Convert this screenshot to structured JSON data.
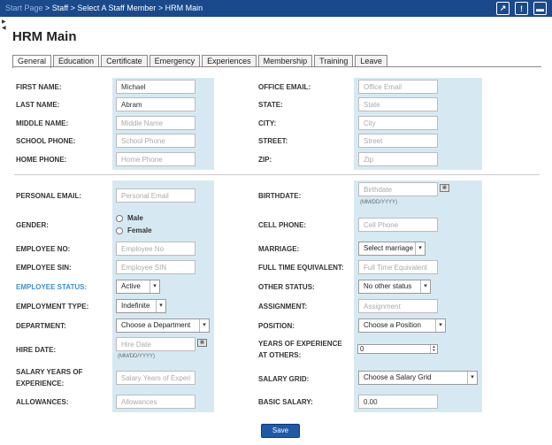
{
  "breadcrumb": {
    "start": "Start Page",
    "separator": " > ",
    "staff": "Staff",
    "select": "Select A Staff Member",
    "current": "HRM Main"
  },
  "top_icons": [
    "external-link-icon",
    "alert-icon",
    "print-icon"
  ],
  "page_title": "HRM Main",
  "tabs": [
    "General",
    "Education",
    "Certificate",
    "Emergency",
    "Experiences",
    "Membership",
    "Training",
    "Leave"
  ],
  "colors": {
    "header": "#1a4a8c",
    "panel": "#d6e9f3",
    "accent": "#3c8fd1",
    "button": "#1e5aa8"
  },
  "form": {
    "first_name": {
      "label": "FIRST NAME:",
      "value": "Michael"
    },
    "last_name": {
      "label": "LAST NAME:",
      "value": "Abram"
    },
    "middle_name": {
      "label": "MIDDLE NAME:",
      "placeholder": "Middle Name"
    },
    "school_phone": {
      "label": "SCHOOL PHONE:",
      "placeholder": "School Phone"
    },
    "home_phone": {
      "label": "HOME PHONE:",
      "placeholder": "Home Phone"
    },
    "office_email": {
      "label": "OFFICE EMAIL:",
      "placeholder": "Office Email"
    },
    "state": {
      "label": "STATE:",
      "placeholder": "State"
    },
    "city": {
      "label": "CITY:",
      "placeholder": "City"
    },
    "street": {
      "label": "STREET:",
      "placeholder": "Street"
    },
    "zip": {
      "label": "ZIP:",
      "placeholder": "Zip"
    },
    "personal_email": {
      "label": "PERSONAL EMAIL:",
      "placeholder": "Personal Email"
    },
    "gender": {
      "label": "GENDER:",
      "male": "Male",
      "female": "Female"
    },
    "employee_no": {
      "label": "EMPLOYEE NO:",
      "placeholder": "Employee No"
    },
    "employee_sin": {
      "label": "EMPLOYEE SIN:",
      "placeholder": "Employee SIN"
    },
    "employee_status": {
      "label": "EMPLOYEE STATUS:",
      "value": "Active"
    },
    "employment_type": {
      "label": "EMPLOYMENT TYPE:",
      "value": "Indefinite"
    },
    "department": {
      "label": "DEPARTMENT:",
      "value": "Choose a Department"
    },
    "hire_date": {
      "label": "HIRE DATE:",
      "placeholder": "Hire Date",
      "hint": "(MM/DD/YYYY)"
    },
    "salary_years": {
      "label": "SALARY YEARS OF EXPERIENCE:",
      "placeholder": "Salary Years of Experien"
    },
    "allowances": {
      "label": "ALLOWANCES:",
      "placeholder": "Allowances"
    },
    "birthdate": {
      "label": "BIRTHDATE:",
      "placeholder": "Birthdate",
      "hint": "(MM/DD/YYYY)"
    },
    "cell_phone": {
      "label": "CELL PHONE:",
      "placeholder": "Cell Phone"
    },
    "marriage": {
      "label": "MARRIAGE:",
      "value": "Select marriage"
    },
    "fte": {
      "label": "FULL TIME EQUIVALENT:",
      "placeholder": "Full Time Equivalent"
    },
    "other_status": {
      "label": "OTHER STATUS:",
      "value": "No other status"
    },
    "assignment": {
      "label": "ASSIGNMENT:",
      "placeholder": "Assignment"
    },
    "position": {
      "label": "POSITION:",
      "value": "Choose a Position"
    },
    "years_exp_others": {
      "label": "YEARS OF EXPERIENCE AT OTHERS:",
      "value": "0"
    },
    "salary_grid": {
      "label": "SALARY GRID:",
      "value": "Choose a Salary Grid"
    },
    "basic_salary": {
      "label": "BASIC SALARY:",
      "value": "0.00"
    }
  },
  "save_label": "Save"
}
